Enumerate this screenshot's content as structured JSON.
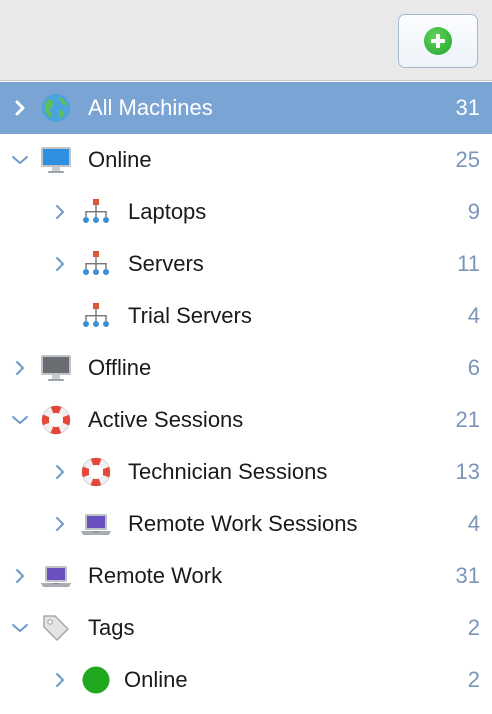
{
  "toolbar": {
    "add_icon": "plus-icon",
    "accent": "#2fb536"
  },
  "tree": {
    "selected_color": "#7aa4d3",
    "count_color": "#7a95b8",
    "items": [
      {
        "label": "All Machines",
        "count": "31",
        "level": 0,
        "disclosure": "expand",
        "icon": "globe-icon",
        "selected": true
      },
      {
        "label": "Online",
        "count": "25",
        "level": 0,
        "disclosure": "collapse",
        "icon": "monitor-icon"
      },
      {
        "label": "Laptops",
        "count": "9",
        "level": 1,
        "disclosure": "expand",
        "icon": "hierarchy-icon"
      },
      {
        "label": "Servers",
        "count": "11",
        "level": 1,
        "disclosure": "expand",
        "icon": "hierarchy-icon"
      },
      {
        "label": "Trial Servers",
        "count": "4",
        "level": 1,
        "disclosure": "none",
        "icon": "hierarchy-icon"
      },
      {
        "label": "Offline",
        "count": "6",
        "level": 0,
        "disclosure": "expand",
        "icon": "monitor-offline-icon"
      },
      {
        "label": "Active Sessions",
        "count": "21",
        "level": 0,
        "disclosure": "collapse",
        "icon": "lifebuoy-icon"
      },
      {
        "label": "Technician Sessions",
        "count": "13",
        "level": 1,
        "disclosure": "expand",
        "icon": "lifebuoy-icon"
      },
      {
        "label": "Remote Work Sessions",
        "count": "4",
        "level": 1,
        "disclosure": "expand",
        "icon": "laptop-icon"
      },
      {
        "label": "Remote Work",
        "count": "31",
        "level": 0,
        "disclosure": "expand",
        "icon": "laptop-icon"
      },
      {
        "label": "Tags",
        "count": "2",
        "level": 0,
        "disclosure": "collapse",
        "icon": "tag-icon"
      },
      {
        "label": "Online",
        "count": "2",
        "level": 1,
        "disclosure": "expand",
        "icon": "green-dot-icon"
      }
    ]
  }
}
